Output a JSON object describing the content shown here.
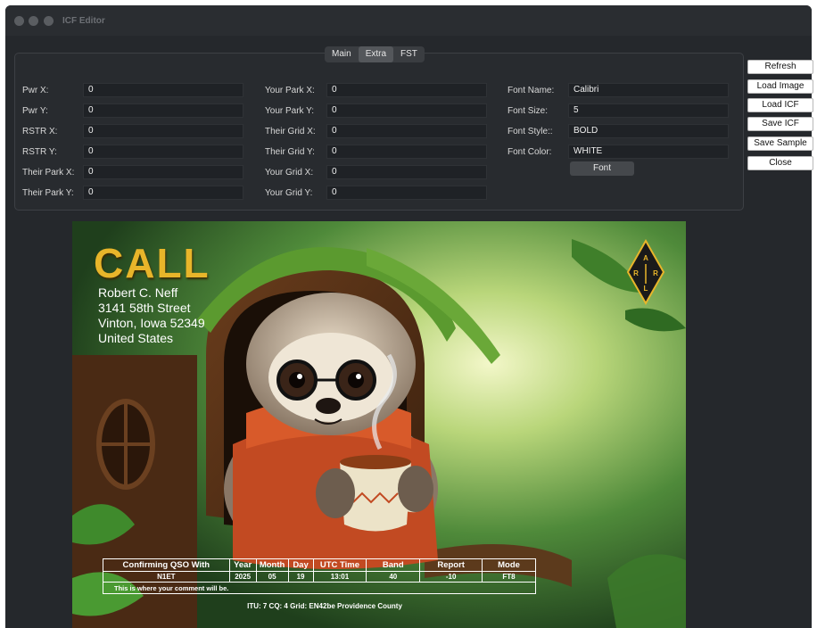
{
  "window": {
    "title": "ICF Editor"
  },
  "tabs": [
    "Main",
    "Extra",
    "FST"
  ],
  "fields": {
    "pwr_x": {
      "label": "Pwr X:",
      "value": "0"
    },
    "pwr_y": {
      "label": "Pwr Y:",
      "value": "0"
    },
    "rstr_x": {
      "label": "RSTR X:",
      "value": "0"
    },
    "rstr_y": {
      "label": "RSTR Y:",
      "value": "0"
    },
    "their_park_x": {
      "label": "Their Park X:",
      "value": "0"
    },
    "their_park_y": {
      "label": "Their Park Y:",
      "value": "0"
    },
    "your_park_x": {
      "label": "Your Park X:",
      "value": "0"
    },
    "your_park_y": {
      "label": "Your Park Y:",
      "value": "0"
    },
    "their_grid_x": {
      "label": "Their Grid X:",
      "value": "0"
    },
    "their_grid_y": {
      "label": "Their Grid Y:",
      "value": "0"
    },
    "your_grid_x": {
      "label": "Your Grid X:",
      "value": "0"
    },
    "your_grid_y": {
      "label": "Your Grid Y:",
      "value": "0"
    },
    "font_name": {
      "label": "Font Name:",
      "value": "Calibri"
    },
    "font_size": {
      "label": "Font Size:",
      "value": "5"
    },
    "font_style": {
      "label": "Font Style::",
      "value": "BOLD"
    },
    "font_color": {
      "label": "Font Color:",
      "value": "WHITE"
    }
  },
  "font_button": "Font",
  "side_buttons": {
    "refresh": "Refresh",
    "load_image": "Load Image",
    "load_icf": "Load ICF",
    "save_icf": "Save ICF",
    "save_sample": "Save Sample",
    "close": "Close"
  },
  "card": {
    "callsign": "CALL",
    "name": "Robert C. Neff",
    "street": "3141 58th Street",
    "city": "Vinton, Iowa 52349",
    "country": "United States",
    "logo_text": "A R R L",
    "table": {
      "headers": [
        "Confirming QSO With",
        "Year",
        "Month",
        "Day",
        "UTC Time",
        "Band",
        "Report",
        "Mode"
      ],
      "values": [
        "N1ET",
        "2025",
        "05",
        "19",
        "13:01",
        "40",
        "-10",
        "FT8"
      ],
      "comment": "This is where your comment will be."
    },
    "footer": "ITU: 7  CQ: 4  Grid: EN42be  Providence  County"
  }
}
